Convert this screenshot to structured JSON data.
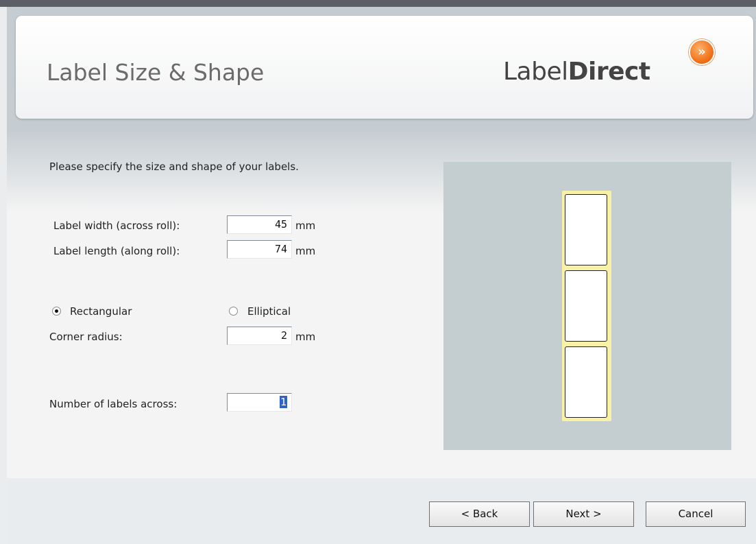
{
  "header": {
    "title": "Label Size & Shape",
    "logo": {
      "text_regular": "Label",
      "text_bold": "Direct",
      "badge_glyph": "»",
      "badge_color": "#f07a1a"
    }
  },
  "instructions": "Please specify the size and shape of your labels.",
  "fields": {
    "width": {
      "label": "Label width (across roll):",
      "value": "45",
      "unit": "mm"
    },
    "length": {
      "label": "Label length (along roll):",
      "value": "74",
      "unit": "mm"
    },
    "corner_radius": {
      "label": "Corner radius:",
      "value": "2",
      "unit": "mm"
    },
    "labels_across": {
      "label": "Number of labels across:",
      "value": "1"
    }
  },
  "shape": {
    "options": [
      {
        "label": "Rectangular",
        "checked": true
      },
      {
        "label": "Elliptical",
        "checked": false
      }
    ]
  },
  "preview": {
    "background": "#c4cdd0",
    "strip_color": "#f8f1a6",
    "label_count": 3
  },
  "buttons": {
    "back": "< Back",
    "next": "Next >",
    "cancel": "Cancel"
  }
}
